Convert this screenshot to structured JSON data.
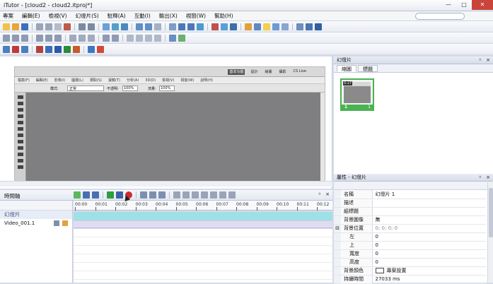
{
  "window": {
    "title": "iTutor - [cloud2 - cloud2.itproj*]",
    "controls": [
      "—",
      "□",
      "✕"
    ]
  },
  "menu": [
    "專案",
    "編輯(E)",
    "檢視(V)",
    "幻燈片(S)",
    "駐釋(A)",
    "互動(I)",
    "輸出(X)",
    "視窗(W)",
    "幫助(H)"
  ],
  "photoshop": {
    "menus": [
      "檔案(F)",
      "編輯(E)",
      "影像(I)",
      "圖層(L)",
      "選取(S)",
      "濾鏡(T)",
      "分析(A)",
      "3D(D)",
      "檢視(V)",
      "視窗(W)",
      "說明(H)"
    ],
    "workspaces": [
      "基本功能",
      "設計",
      "繪畫",
      "攝影"
    ],
    "live_label": "CS Live",
    "options": {
      "mode_label": "模式:",
      "mode_value": "正常",
      "opacity_label": "不透明:",
      "opacity_value": "100%",
      "flow_label": "流量:",
      "flow_value": "100%"
    }
  },
  "timeline": {
    "title": "時間軸",
    "ticks": [
      "00:00",
      "00:01",
      "00:02",
      "00:03",
      "00:04",
      "00:05",
      "00:06",
      "00:07",
      "00:08",
      "00:09",
      "00:10",
      "00:11",
      "00:12"
    ],
    "rows": [
      {
        "label": "幻燈片"
      },
      {
        "label": "Video_001.1"
      }
    ]
  },
  "slides_panel": {
    "title": "幻燈片",
    "tabs": [
      "縮圖",
      "標題"
    ],
    "thumb": {
      "time": "0:27",
      "index": "1",
      "count": "1"
    }
  },
  "properties_panel": {
    "title": "屬性 - 幻燈片",
    "rows": [
      {
        "key": "名稱",
        "value": "幻燈片 1"
      },
      {
        "key": "描述",
        "value": ""
      },
      {
        "key": "組標題",
        "value": ""
      },
      {
        "key": "背景圖像",
        "value": "無"
      },
      {
        "key": "背景位置",
        "value": "0; 0; 0; 0"
      },
      {
        "key": "左",
        "value": "0"
      },
      {
        "key": "上",
        "value": "0"
      },
      {
        "key": "寬度",
        "value": "0"
      },
      {
        "key": "高度",
        "value": "0"
      },
      {
        "key": "背景顏色",
        "value": "專案設置"
      },
      {
        "key": "持續時間",
        "value": "27033 ms"
      }
    ]
  },
  "colors": {
    "accent_green": "#4bb153",
    "track_cyan": "#9fdfe6",
    "track_lavender": "#e2dcf2"
  }
}
